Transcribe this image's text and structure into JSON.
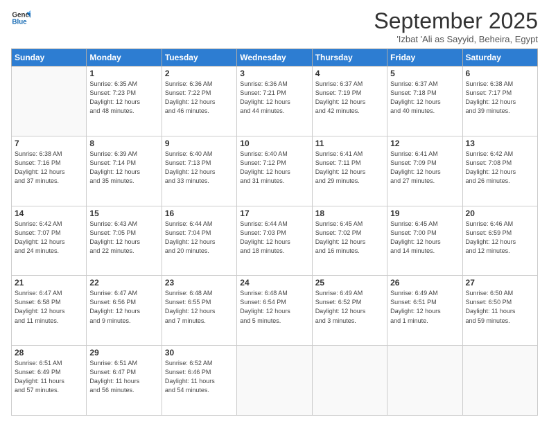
{
  "logo": {
    "line1": "General",
    "line2": "Blue"
  },
  "title": "September 2025",
  "subtitle": "'Izbat 'Ali as Sayyid, Beheira, Egypt",
  "days_of_week": [
    "Sunday",
    "Monday",
    "Tuesday",
    "Wednesday",
    "Thursday",
    "Friday",
    "Saturday"
  ],
  "weeks": [
    [
      {
        "day": "",
        "info": ""
      },
      {
        "day": "1",
        "info": "Sunrise: 6:35 AM\nSunset: 7:23 PM\nDaylight: 12 hours\nand 48 minutes."
      },
      {
        "day": "2",
        "info": "Sunrise: 6:36 AM\nSunset: 7:22 PM\nDaylight: 12 hours\nand 46 minutes."
      },
      {
        "day": "3",
        "info": "Sunrise: 6:36 AM\nSunset: 7:21 PM\nDaylight: 12 hours\nand 44 minutes."
      },
      {
        "day": "4",
        "info": "Sunrise: 6:37 AM\nSunset: 7:19 PM\nDaylight: 12 hours\nand 42 minutes."
      },
      {
        "day": "5",
        "info": "Sunrise: 6:37 AM\nSunset: 7:18 PM\nDaylight: 12 hours\nand 40 minutes."
      },
      {
        "day": "6",
        "info": "Sunrise: 6:38 AM\nSunset: 7:17 PM\nDaylight: 12 hours\nand 39 minutes."
      }
    ],
    [
      {
        "day": "7",
        "info": "Sunrise: 6:38 AM\nSunset: 7:16 PM\nDaylight: 12 hours\nand 37 minutes."
      },
      {
        "day": "8",
        "info": "Sunrise: 6:39 AM\nSunset: 7:14 PM\nDaylight: 12 hours\nand 35 minutes."
      },
      {
        "day": "9",
        "info": "Sunrise: 6:40 AM\nSunset: 7:13 PM\nDaylight: 12 hours\nand 33 minutes."
      },
      {
        "day": "10",
        "info": "Sunrise: 6:40 AM\nSunset: 7:12 PM\nDaylight: 12 hours\nand 31 minutes."
      },
      {
        "day": "11",
        "info": "Sunrise: 6:41 AM\nSunset: 7:11 PM\nDaylight: 12 hours\nand 29 minutes."
      },
      {
        "day": "12",
        "info": "Sunrise: 6:41 AM\nSunset: 7:09 PM\nDaylight: 12 hours\nand 27 minutes."
      },
      {
        "day": "13",
        "info": "Sunrise: 6:42 AM\nSunset: 7:08 PM\nDaylight: 12 hours\nand 26 minutes."
      }
    ],
    [
      {
        "day": "14",
        "info": "Sunrise: 6:42 AM\nSunset: 7:07 PM\nDaylight: 12 hours\nand 24 minutes."
      },
      {
        "day": "15",
        "info": "Sunrise: 6:43 AM\nSunset: 7:05 PM\nDaylight: 12 hours\nand 22 minutes."
      },
      {
        "day": "16",
        "info": "Sunrise: 6:44 AM\nSunset: 7:04 PM\nDaylight: 12 hours\nand 20 minutes."
      },
      {
        "day": "17",
        "info": "Sunrise: 6:44 AM\nSunset: 7:03 PM\nDaylight: 12 hours\nand 18 minutes."
      },
      {
        "day": "18",
        "info": "Sunrise: 6:45 AM\nSunset: 7:02 PM\nDaylight: 12 hours\nand 16 minutes."
      },
      {
        "day": "19",
        "info": "Sunrise: 6:45 AM\nSunset: 7:00 PM\nDaylight: 12 hours\nand 14 minutes."
      },
      {
        "day": "20",
        "info": "Sunrise: 6:46 AM\nSunset: 6:59 PM\nDaylight: 12 hours\nand 12 minutes."
      }
    ],
    [
      {
        "day": "21",
        "info": "Sunrise: 6:47 AM\nSunset: 6:58 PM\nDaylight: 12 hours\nand 11 minutes."
      },
      {
        "day": "22",
        "info": "Sunrise: 6:47 AM\nSunset: 6:56 PM\nDaylight: 12 hours\nand 9 minutes."
      },
      {
        "day": "23",
        "info": "Sunrise: 6:48 AM\nSunset: 6:55 PM\nDaylight: 12 hours\nand 7 minutes."
      },
      {
        "day": "24",
        "info": "Sunrise: 6:48 AM\nSunset: 6:54 PM\nDaylight: 12 hours\nand 5 minutes."
      },
      {
        "day": "25",
        "info": "Sunrise: 6:49 AM\nSunset: 6:52 PM\nDaylight: 12 hours\nand 3 minutes."
      },
      {
        "day": "26",
        "info": "Sunrise: 6:49 AM\nSunset: 6:51 PM\nDaylight: 12 hours\nand 1 minute."
      },
      {
        "day": "27",
        "info": "Sunrise: 6:50 AM\nSunset: 6:50 PM\nDaylight: 11 hours\nand 59 minutes."
      }
    ],
    [
      {
        "day": "28",
        "info": "Sunrise: 6:51 AM\nSunset: 6:49 PM\nDaylight: 11 hours\nand 57 minutes."
      },
      {
        "day": "29",
        "info": "Sunrise: 6:51 AM\nSunset: 6:47 PM\nDaylight: 11 hours\nand 56 minutes."
      },
      {
        "day": "30",
        "info": "Sunrise: 6:52 AM\nSunset: 6:46 PM\nDaylight: 11 hours\nand 54 minutes."
      },
      {
        "day": "",
        "info": ""
      },
      {
        "day": "",
        "info": ""
      },
      {
        "day": "",
        "info": ""
      },
      {
        "day": "",
        "info": ""
      }
    ]
  ]
}
